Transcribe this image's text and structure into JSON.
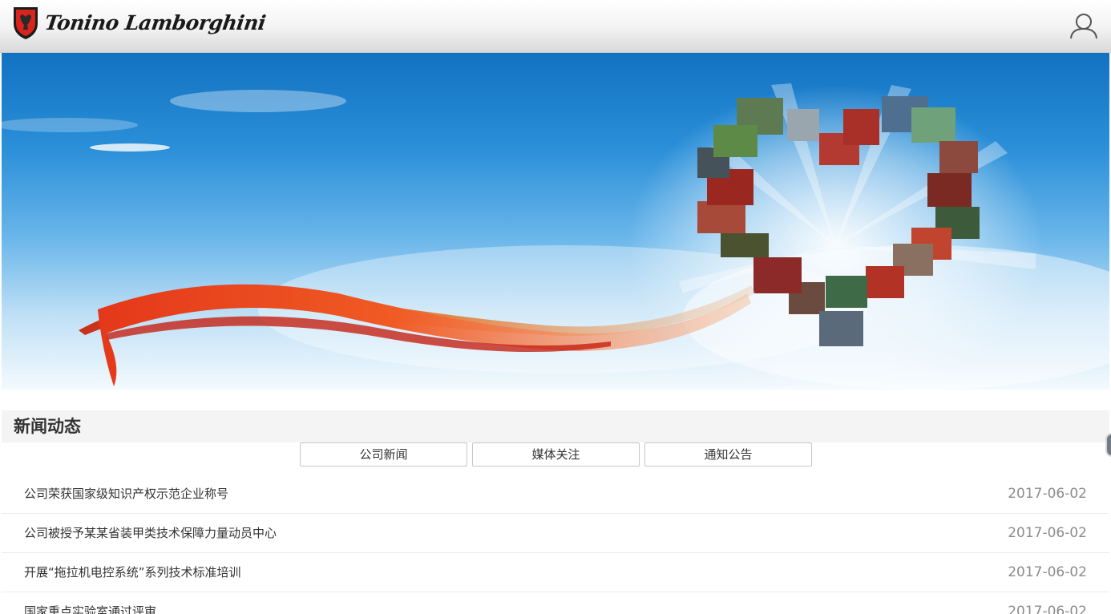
{
  "header": {
    "brand_name": "Tonino Lamborghini",
    "logo_icon": "bull-shield-icon",
    "user_icon": "user-icon"
  },
  "colors": {
    "header_bg": "#f2f2f2",
    "sky_top": "#1272c2",
    "ribbon": "#e8401a",
    "text": "#333333",
    "date": "#8c8c8c"
  },
  "section": {
    "title": "新闻动态"
  },
  "tabs": [
    {
      "label": "公司新闻"
    },
    {
      "label": "媒体关注"
    },
    {
      "label": "通知公告"
    }
  ],
  "news": [
    {
      "title": "公司荣获国家级知识产权示范企业称号",
      "date": "2017-06-02"
    },
    {
      "title": "公司被授予某某省装甲类技术保障力量动员中心",
      "date": "2017-06-02"
    },
    {
      "title": "开展“拖拉机电控系统”系列技术标准培训",
      "date": "2017-06-02"
    },
    {
      "title": "国家重点实验室通过评审",
      "date": "2017-06-02"
    }
  ]
}
